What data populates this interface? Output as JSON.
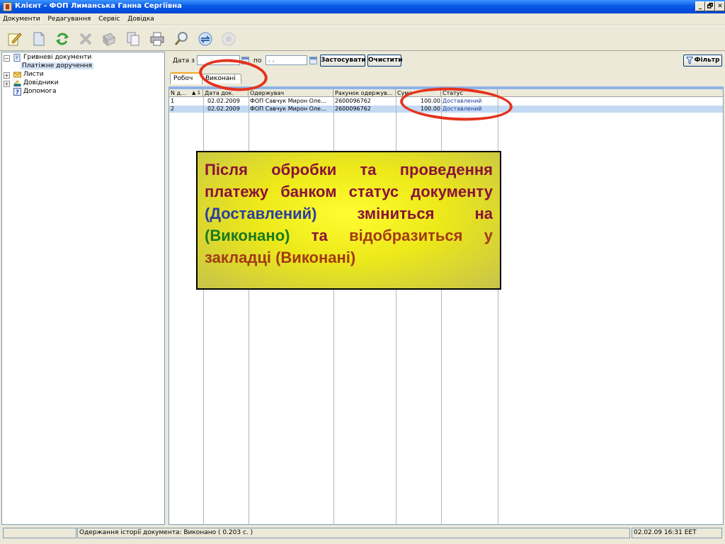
{
  "window": {
    "title": "Клієнт - ФОП Лиманська Ганна Сергіївна",
    "controls": {
      "minimize": "_",
      "restore": "🗗",
      "close": "✕"
    }
  },
  "menu": [
    "Документи",
    "Редагування",
    "Сервіс",
    "Довідка"
  ],
  "toolbar": {
    "icons": [
      "edit-icon",
      "new-document-icon",
      "refresh-icon",
      "delete-icon",
      "archive-icon",
      "copy-icon",
      "print-icon",
      "search-icon",
      "exchange-icon",
      "disabled-icon"
    ]
  },
  "tree": {
    "items": [
      {
        "label": "Гривневі документи",
        "expander": "−",
        "icon": "document-icon"
      },
      {
        "label": "Платіжне доручення",
        "selected": true
      },
      {
        "label": "Листи",
        "expander": "+",
        "icon": "envelope-icon"
      },
      {
        "label": "Довідники",
        "expander": "+",
        "icon": "books-icon"
      },
      {
        "label": "Допомога",
        "icon": "help-icon"
      }
    ]
  },
  "filter": {
    "date_from_label": "Дата з",
    "date_to_label": "по",
    "date_to_value": ".   .",
    "apply_button": "Застосувати",
    "clear_button": "Очистити",
    "filter_button": "Фільтр"
  },
  "tabs": [
    {
      "label": "Робоч",
      "active": true
    },
    {
      "label": "Виконані",
      "active": false
    }
  ],
  "table": {
    "columns": [
      "N д...",
      "Дата док.",
      "Одержувач",
      "Рахунок одержув...",
      "Сума",
      "Статус"
    ],
    "sort_indicator": "▲ 1",
    "rows": [
      {
        "num": "1",
        "date": "02.02.2009",
        "recipient": "ФОП Савчук Мирон Оле...",
        "account": "2600096762",
        "sum": "100.00",
        "status": "Доставлений"
      },
      {
        "num": "2",
        "date": "02.02.2009",
        "recipient": "ФОП Савчук Мирон Оле...",
        "account": "2600096762",
        "sum": "100.00",
        "status": "Доставлений"
      }
    ]
  },
  "callout": {
    "part1": "Після обробки та проведення платежу банком статус документу",
    "part2": "(Доставлений)",
    "part3": "зміниться на",
    "part4": "(Виконано)",
    "part5": "та",
    "part6": "відобразиться у закладці (Виконані)"
  },
  "statusbar": {
    "message": "Одержання історії документа: Виконано ( 0.203 с. )",
    "datetime": "02.02.09 16:31 EET"
  },
  "colors": {
    "highlight_ellipse": "#e4331d",
    "callout_bg": "#fffd30",
    "status_text": "#1f3e9a"
  }
}
